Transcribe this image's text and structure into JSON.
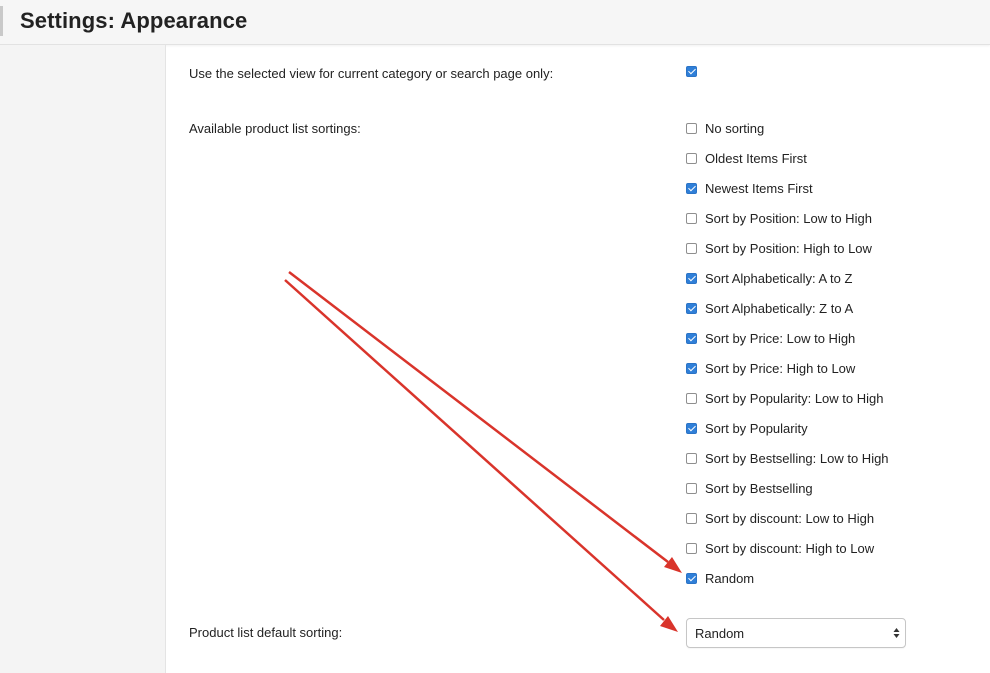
{
  "header": {
    "title": "Settings: Appearance"
  },
  "settings": {
    "selected_view": {
      "label": "Use the selected view for current category or search page only:",
      "checked": true
    },
    "sortings": {
      "label": "Available product list sortings:",
      "options": [
        {
          "label": "No sorting",
          "checked": false
        },
        {
          "label": "Oldest Items First",
          "checked": false
        },
        {
          "label": "Newest Items First",
          "checked": true
        },
        {
          "label": "Sort by Position: Low to High",
          "checked": false
        },
        {
          "label": "Sort by Position: High to Low",
          "checked": false
        },
        {
          "label": "Sort Alphabetically: A to Z",
          "checked": true
        },
        {
          "label": "Sort Alphabetically: Z to A",
          "checked": true
        },
        {
          "label": "Sort by Price: Low to High",
          "checked": true
        },
        {
          "label": "Sort by Price: High to Low",
          "checked": true
        },
        {
          "label": "Sort by Popularity: Low to High",
          "checked": false
        },
        {
          "label": "Sort by Popularity",
          "checked": true
        },
        {
          "label": "Sort by Bestselling: Low to High",
          "checked": false
        },
        {
          "label": "Sort by Bestselling",
          "checked": false
        },
        {
          "label": "Sort by discount: Low to High",
          "checked": false
        },
        {
          "label": "Sort by discount: High to Low",
          "checked": false
        },
        {
          "label": "Random",
          "checked": true
        }
      ]
    },
    "default_sorting": {
      "label": "Product list default sorting:",
      "value": "Random"
    }
  },
  "colors": {
    "checkbox_accent": "#2f7fd8",
    "annotation_arrow": "#d9342b"
  }
}
